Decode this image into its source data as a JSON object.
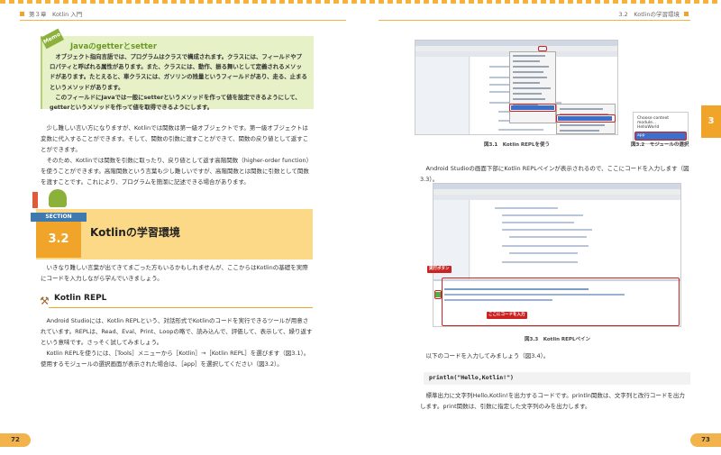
{
  "left": {
    "running_head": "第３章　Kotlin 入門",
    "page_number": "72",
    "memo": {
      "tag": "Memo",
      "title": "Javaのgetterとsetter",
      "body1": "オブジェクト指向言語では、プログラムはクラスで構成されます。クラスには、フィールドやプロパティと呼ばれる属性があります。また、クラスには、動作、振る舞いとして定義されるメソッドがあります。たとえると、車クラスには、ガソリンの残量というフィールドがあり、走る、止まるというメソッドがあります。",
      "body2": "このフィールドにJavaでは一般にsetterというメソッドを作って値を設定できるようにして、getterというメソッドを作って値を取得できるようにします。"
    },
    "para1": "少し難しい言い方になりますが、Kotlinでは関数は第一級オブジェクトです。第一級オブジェクトは変数に代入することができます。そして、関数の引数に渡すことができて、関数の戻り値として返すことができます。",
    "para2": "そのため、Kotlinでは関数を引数に取ったり、戻り値として返す高階関数（higher-order function）を使うことができます。高階関数という言葉も少し難しいですが、高階関数とは関数に引数として関数を渡すことです。これにより、プログラムを簡潔に記述できる場合があります。",
    "section": {
      "tag": "SECTION",
      "number": "3.2",
      "title": "Kotlinの学習環境"
    },
    "para3": "いきなり難しい言葉が出てきてまごった方もいるかもしれませんが、ここからはKotlinの基礎を実際にコードを入力しながら学んでいきましょう。",
    "subhead": "Kotlin REPL",
    "para4": "Android Studioには、Kotlin REPLという、対話形式でKotlinのコードを実行できるツールが用意されています。REPLは、Read、Eval、Print、Loopの略で、読み込んで、評価して、表示して、繰り返すという意味です。さっそく試してみましょう。",
    "para5": "Kotlin REPLを使うには、［Tools］メニューから［Kotlin］→［Kotlin REPL］を選びます（図3.1）。使用するモジュールの選択画面が表示された場合は、［app］を選択してください（図3.2）。"
  },
  "right": {
    "running_head": "3.2　Kotlinの学習環境",
    "page_number": "73",
    "chapter_thumb": "3",
    "fig1_caption": "図3.1　Kotlin REPLを使う",
    "fig2_caption": "図3.2　モジュールの選択",
    "fig2_popup": [
      "Choose context module...",
      "HelloWorld",
      "app"
    ],
    "para1": "Android Studioの画面下部にKotlin REPLペインが表示されるので、ここにコードを入力します（図3.3）。",
    "fig3_callout_run": "実行ボタン",
    "fig3_callout_input": "ここにコードを入力",
    "fig3_caption": "図3.3　Kotlin REPLペイン",
    "para2": "以下のコードを入力してみましょう（図3.4）。",
    "code": "println(\"Hello,Kotlin!\")",
    "para3": "標準出力に文字列Hello,Kotlin!を出力するコードです。println関数は、文字列と改行コードを出力します。print関数は、引数に指定した文字列のみを出力します。"
  },
  "colors": {
    "accent": "#f0a52a",
    "memo_bg": "#e6f1c8",
    "memo_title": "#6a9a1f",
    "section_band": "#fbd987",
    "highlight": "#cc2222"
  }
}
